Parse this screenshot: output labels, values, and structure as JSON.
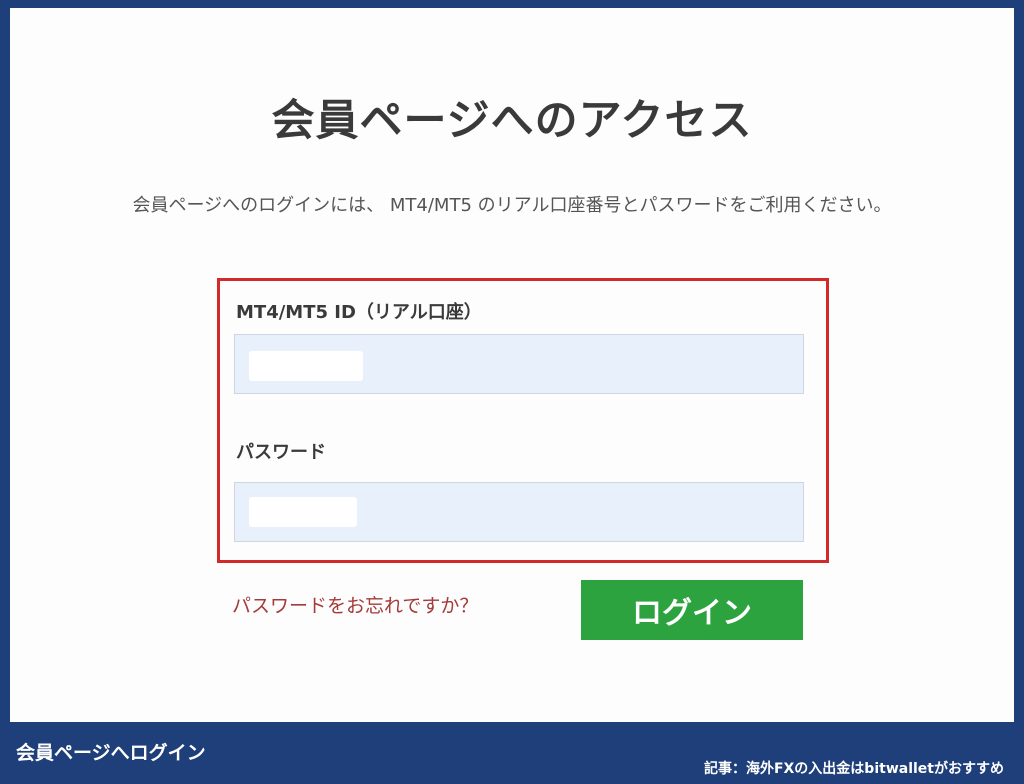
{
  "login_page": {
    "title": "会員ページへのアクセス",
    "instruction": "会員ページへのログインには、 MT4/MT5 のリアル口座番号とパスワードをご利用ください。",
    "id_field": {
      "label": "MT4/MT5 ID（リアル口座）",
      "value": ""
    },
    "password_field": {
      "label": "パスワード",
      "value": ""
    },
    "forgot_link": "パスワードをお忘れですか？",
    "login_button": "ログイン",
    "colors": {
      "highlight": "#d22a2a",
      "button": "#2ca33e",
      "link": "#a43a3a",
      "input_bg": "#e8f0fb",
      "banner": "#1f3f7a"
    }
  },
  "footer": {
    "caption": "会員ページへログイン",
    "article": "記事：海外FXの入出金はbitwalletがおすすめ"
  }
}
